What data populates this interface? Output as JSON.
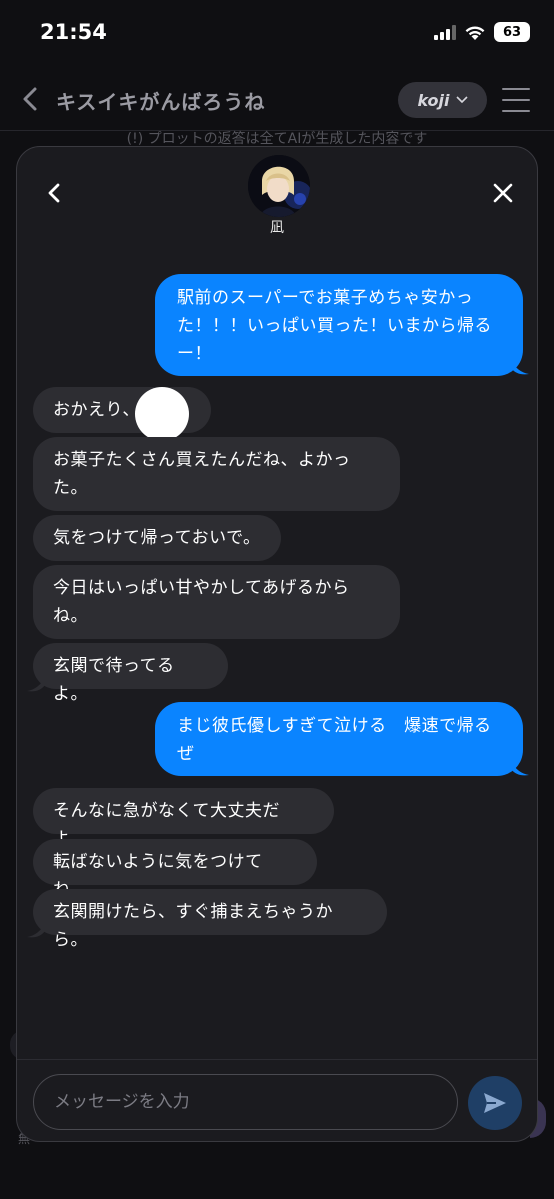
{
  "status": {
    "time": "21:54",
    "battery": "63"
  },
  "background": {
    "title": "キスイキがんばろうね",
    "model_label": "koji",
    "notice": "(!) プロットの返答は全てAIが生成した内容です",
    "footer_text": "無"
  },
  "modal": {
    "character_name": "凪",
    "input_placeholder": "メッセージを入力"
  },
  "messages": [
    {
      "role": "user",
      "text": "駅前のスーパーでお菓子めちゃ安かった！！！いっぱい買った！いまから帰るー！",
      "lines": [
        "駅前のスーパーでお菓子めちゃ安かっ",
        "た！！！いっぱい買った！いまから帰る",
        "ー！"
      ]
    },
    {
      "role": "ai",
      "text": "おかえり、"
    },
    {
      "role": "ai",
      "text": "お菓子たくさん買えたんだね、よかった。",
      "lines": [
        "お菓子たくさん買えたんだね、よかっ",
        "た。"
      ]
    },
    {
      "role": "ai",
      "text": "気をつけて帰っておいで。"
    },
    {
      "role": "ai",
      "text": "今日はいっぱい甘やかしてあげるからね。",
      "lines": [
        "今日はいっぱい甘やかしてあげるから",
        "ね。"
      ]
    },
    {
      "role": "ai",
      "text": "玄関で待ってるよ。"
    },
    {
      "role": "user",
      "text": "まじ彼氏優しすぎて泣ける　爆速で帰るぜ",
      "lines": [
        "まじ彼氏優しすぎて泣ける　爆速で帰る",
        "ぜ"
      ]
    },
    {
      "role": "ai",
      "text": "そんなに急がなくて大丈夫だよ。"
    },
    {
      "role": "ai",
      "text": "転ばないように気をつけてね。"
    },
    {
      "role": "ai",
      "text": "玄関開けたら、すぐ捕まえちゃうから。"
    }
  ],
  "colors": {
    "user_bubble": "#0a84ff",
    "ai_bubble": "#2d2d32",
    "background": "#0f0f12",
    "modal": "#1b1b1f"
  },
  "icons": {
    "back": "chevron-left-icon",
    "close": "close-icon",
    "send": "paper-plane-icon",
    "menu": "hamburger-menu-icon"
  }
}
